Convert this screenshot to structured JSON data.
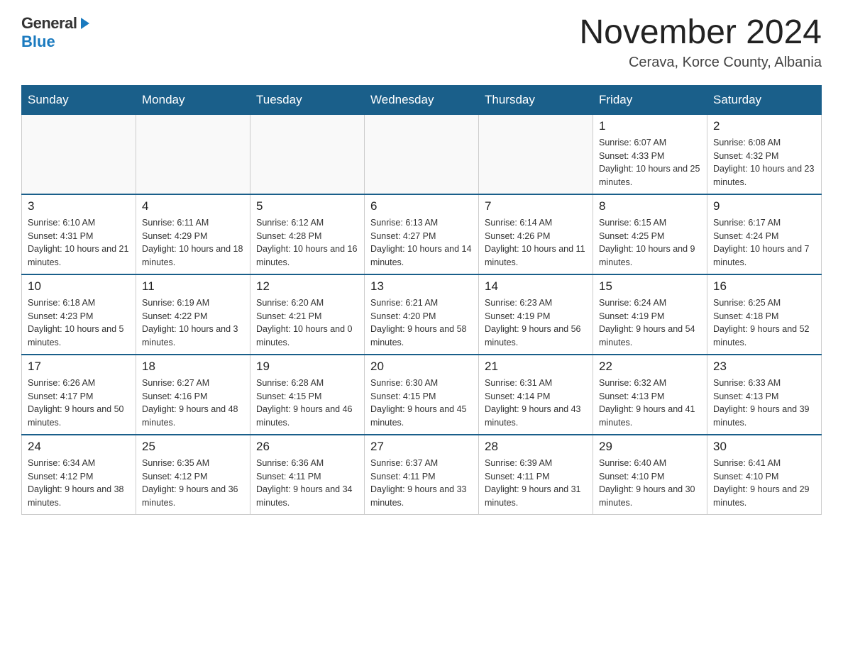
{
  "logo": {
    "general": "General",
    "blue": "Blue",
    "arrow": "▶"
  },
  "title": {
    "month_year": "November 2024",
    "location": "Cerava, Korce County, Albania"
  },
  "days_of_week": [
    "Sunday",
    "Monday",
    "Tuesday",
    "Wednesday",
    "Thursday",
    "Friday",
    "Saturday"
  ],
  "weeks": [
    [
      {
        "day": "",
        "info": ""
      },
      {
        "day": "",
        "info": ""
      },
      {
        "day": "",
        "info": ""
      },
      {
        "day": "",
        "info": ""
      },
      {
        "day": "",
        "info": ""
      },
      {
        "day": "1",
        "info": "Sunrise: 6:07 AM\nSunset: 4:33 PM\nDaylight: 10 hours and 25 minutes."
      },
      {
        "day": "2",
        "info": "Sunrise: 6:08 AM\nSunset: 4:32 PM\nDaylight: 10 hours and 23 minutes."
      }
    ],
    [
      {
        "day": "3",
        "info": "Sunrise: 6:10 AM\nSunset: 4:31 PM\nDaylight: 10 hours and 21 minutes."
      },
      {
        "day": "4",
        "info": "Sunrise: 6:11 AM\nSunset: 4:29 PM\nDaylight: 10 hours and 18 minutes."
      },
      {
        "day": "5",
        "info": "Sunrise: 6:12 AM\nSunset: 4:28 PM\nDaylight: 10 hours and 16 minutes."
      },
      {
        "day": "6",
        "info": "Sunrise: 6:13 AM\nSunset: 4:27 PM\nDaylight: 10 hours and 14 minutes."
      },
      {
        "day": "7",
        "info": "Sunrise: 6:14 AM\nSunset: 4:26 PM\nDaylight: 10 hours and 11 minutes."
      },
      {
        "day": "8",
        "info": "Sunrise: 6:15 AM\nSunset: 4:25 PM\nDaylight: 10 hours and 9 minutes."
      },
      {
        "day": "9",
        "info": "Sunrise: 6:17 AM\nSunset: 4:24 PM\nDaylight: 10 hours and 7 minutes."
      }
    ],
    [
      {
        "day": "10",
        "info": "Sunrise: 6:18 AM\nSunset: 4:23 PM\nDaylight: 10 hours and 5 minutes."
      },
      {
        "day": "11",
        "info": "Sunrise: 6:19 AM\nSunset: 4:22 PM\nDaylight: 10 hours and 3 minutes."
      },
      {
        "day": "12",
        "info": "Sunrise: 6:20 AM\nSunset: 4:21 PM\nDaylight: 10 hours and 0 minutes."
      },
      {
        "day": "13",
        "info": "Sunrise: 6:21 AM\nSunset: 4:20 PM\nDaylight: 9 hours and 58 minutes."
      },
      {
        "day": "14",
        "info": "Sunrise: 6:23 AM\nSunset: 4:19 PM\nDaylight: 9 hours and 56 minutes."
      },
      {
        "day": "15",
        "info": "Sunrise: 6:24 AM\nSunset: 4:19 PM\nDaylight: 9 hours and 54 minutes."
      },
      {
        "day": "16",
        "info": "Sunrise: 6:25 AM\nSunset: 4:18 PM\nDaylight: 9 hours and 52 minutes."
      }
    ],
    [
      {
        "day": "17",
        "info": "Sunrise: 6:26 AM\nSunset: 4:17 PM\nDaylight: 9 hours and 50 minutes."
      },
      {
        "day": "18",
        "info": "Sunrise: 6:27 AM\nSunset: 4:16 PM\nDaylight: 9 hours and 48 minutes."
      },
      {
        "day": "19",
        "info": "Sunrise: 6:28 AM\nSunset: 4:15 PM\nDaylight: 9 hours and 46 minutes."
      },
      {
        "day": "20",
        "info": "Sunrise: 6:30 AM\nSunset: 4:15 PM\nDaylight: 9 hours and 45 minutes."
      },
      {
        "day": "21",
        "info": "Sunrise: 6:31 AM\nSunset: 4:14 PM\nDaylight: 9 hours and 43 minutes."
      },
      {
        "day": "22",
        "info": "Sunrise: 6:32 AM\nSunset: 4:13 PM\nDaylight: 9 hours and 41 minutes."
      },
      {
        "day": "23",
        "info": "Sunrise: 6:33 AM\nSunset: 4:13 PM\nDaylight: 9 hours and 39 minutes."
      }
    ],
    [
      {
        "day": "24",
        "info": "Sunrise: 6:34 AM\nSunset: 4:12 PM\nDaylight: 9 hours and 38 minutes."
      },
      {
        "day": "25",
        "info": "Sunrise: 6:35 AM\nSunset: 4:12 PM\nDaylight: 9 hours and 36 minutes."
      },
      {
        "day": "26",
        "info": "Sunrise: 6:36 AM\nSunset: 4:11 PM\nDaylight: 9 hours and 34 minutes."
      },
      {
        "day": "27",
        "info": "Sunrise: 6:37 AM\nSunset: 4:11 PM\nDaylight: 9 hours and 33 minutes."
      },
      {
        "day": "28",
        "info": "Sunrise: 6:39 AM\nSunset: 4:11 PM\nDaylight: 9 hours and 31 minutes."
      },
      {
        "day": "29",
        "info": "Sunrise: 6:40 AM\nSunset: 4:10 PM\nDaylight: 9 hours and 30 minutes."
      },
      {
        "day": "30",
        "info": "Sunrise: 6:41 AM\nSunset: 4:10 PM\nDaylight: 9 hours and 29 minutes."
      }
    ]
  ]
}
